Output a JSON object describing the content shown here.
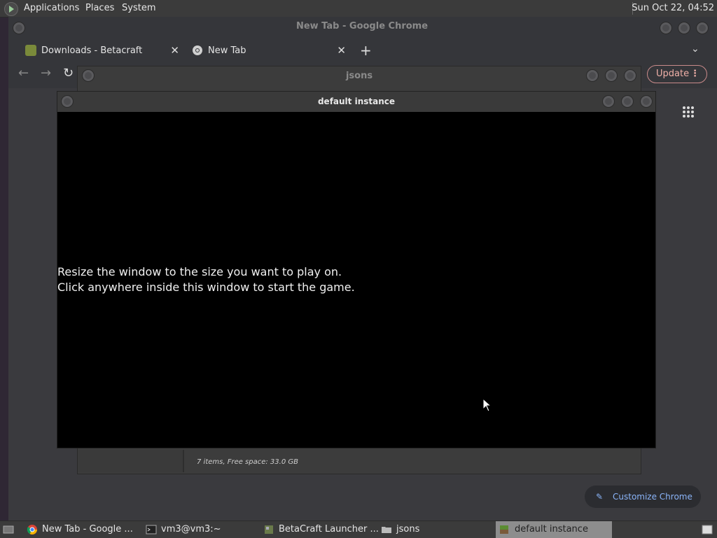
{
  "top_panel": {
    "menus": [
      "Applications",
      "Places",
      "System"
    ],
    "clock": "Sun Oct 22, 04:52"
  },
  "chrome": {
    "window_title": "New Tab - Google Chrome",
    "tabs": [
      {
        "label": "Downloads - Betacraft",
        "icon": "betacraft-icon"
      },
      {
        "label": "New Tab",
        "icon": "chrome-icon"
      }
    ],
    "update_label": "Update",
    "customize_label": "Customize Chrome"
  },
  "file_manager": {
    "title": "jsons",
    "status": "7 items, Free space: 33.0 GB"
  },
  "game_window": {
    "title": "default instance",
    "message_line1": "Resize the window to the size you want to play on.",
    "message_line2": "Click anywhere inside this window to start the game."
  },
  "taskbar": {
    "items": [
      {
        "label": "New Tab - Google ...",
        "icon": "chrome-icon"
      },
      {
        "label": "vm3@vm3:~",
        "icon": "terminal-icon"
      },
      {
        "label": "BetaCraft Launcher ...",
        "icon": "betacraft-icon"
      },
      {
        "label": "jsons",
        "icon": "folder-icon"
      },
      {
        "label": "default instance",
        "icon": "minecraft-icon"
      }
    ]
  }
}
